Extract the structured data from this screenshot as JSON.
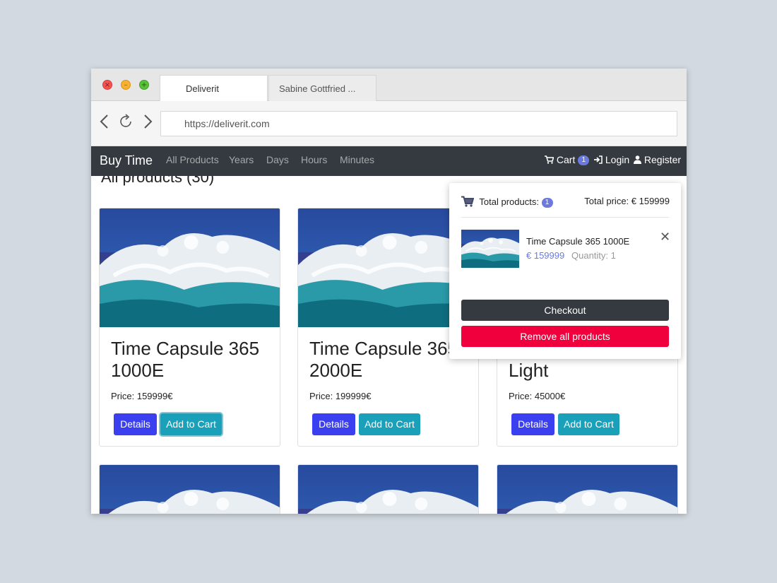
{
  "browser": {
    "tabs": [
      {
        "label": "Deliverit"
      },
      {
        "label": "Sabine Gottfried ..."
      }
    ],
    "url": "https://deliverit.com",
    "icons": {
      "close": "close-icon",
      "minimize": "minimize-icon",
      "maximize": "maximize-icon",
      "back": "arrow-left-icon",
      "reload": "reload-icon",
      "forward": "arrow-right-icon"
    }
  },
  "nav": {
    "brand": "Buy Time",
    "links": [
      "All Products",
      "Years",
      "Days",
      "Hours",
      "Minutes"
    ],
    "cart_label": "Cart",
    "cart_count": "1",
    "login": "Login",
    "register": "Register"
  },
  "main": {
    "heading": "All products (30)",
    "products": [
      {
        "title": "Time Capsule 365 1000E",
        "price": "Price: 159999€"
      },
      {
        "title": "Time Capsule 365 2000E",
        "price": "Price: 199999€"
      },
      {
        "title": "Light",
        "price": "Price: 45000€"
      }
    ],
    "details_label": "Details",
    "add_label": "Add to Cart"
  },
  "cart_dropdown": {
    "total_products_label": "Total products:",
    "total_products_count": "1",
    "total_price": "Total price: € 159999",
    "item": {
      "name": "Time Capsule 365 1000E",
      "price": "€ 159999",
      "quantity": "Quantity: 1"
    },
    "checkout": "Checkout",
    "remove_all": "Remove all products"
  },
  "colors": {
    "navbar": "#343a40",
    "primary": "#3a3ff0",
    "info": "#1aa0b8",
    "danger": "#f0003c",
    "badge": "#6c7ae0"
  }
}
